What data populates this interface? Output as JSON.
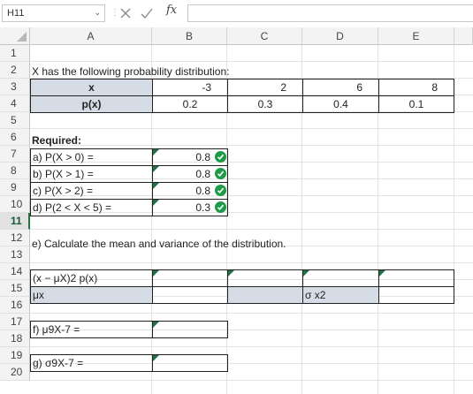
{
  "formula_bar": {
    "name_box": "H11",
    "fx_label": "fx",
    "formula": ""
  },
  "columns": [
    "A",
    "B",
    "C",
    "D",
    "E"
  ],
  "rows": [
    "1",
    "2",
    "3",
    "4",
    "5",
    "6",
    "7",
    "8",
    "9",
    "10",
    "11",
    "12",
    "13",
    "14",
    "15",
    "16",
    "17",
    "18",
    "19",
    "20"
  ],
  "selected_row": "11",
  "sheet": {
    "intro": "X has the following probability distribution:",
    "table": {
      "x_label": "x",
      "p_label": "p(x)",
      "x_values": [
        "-3",
        "2",
        "6",
        "8"
      ],
      "p_values": [
        "0.2",
        "0.3",
        "0.4",
        "0.1"
      ]
    },
    "required_label": "Required:",
    "questions": [
      {
        "label": "a) P(X > 0) =",
        "answer": "0.8"
      },
      {
        "label": "b) P(X > 1) =",
        "answer": "0.8"
      },
      {
        "label": "c) P(X > 2) =",
        "answer": "0.8"
      },
      {
        "label": "d) P(2 < X < 5) =",
        "answer": "0.3"
      }
    ],
    "part_e": "e) Calculate the mean and variance of the distribution.",
    "row14_label": "(x − μX)2 p(x)",
    "row15_label": "μx",
    "row15_sigma": "σ x2",
    "part_f": "f) μ9X-7 =",
    "part_g": "g) σ9X-7 ="
  },
  "colors": {
    "accent": "#217346",
    "shade": "#d6dce5",
    "check": "#1e9b46"
  }
}
